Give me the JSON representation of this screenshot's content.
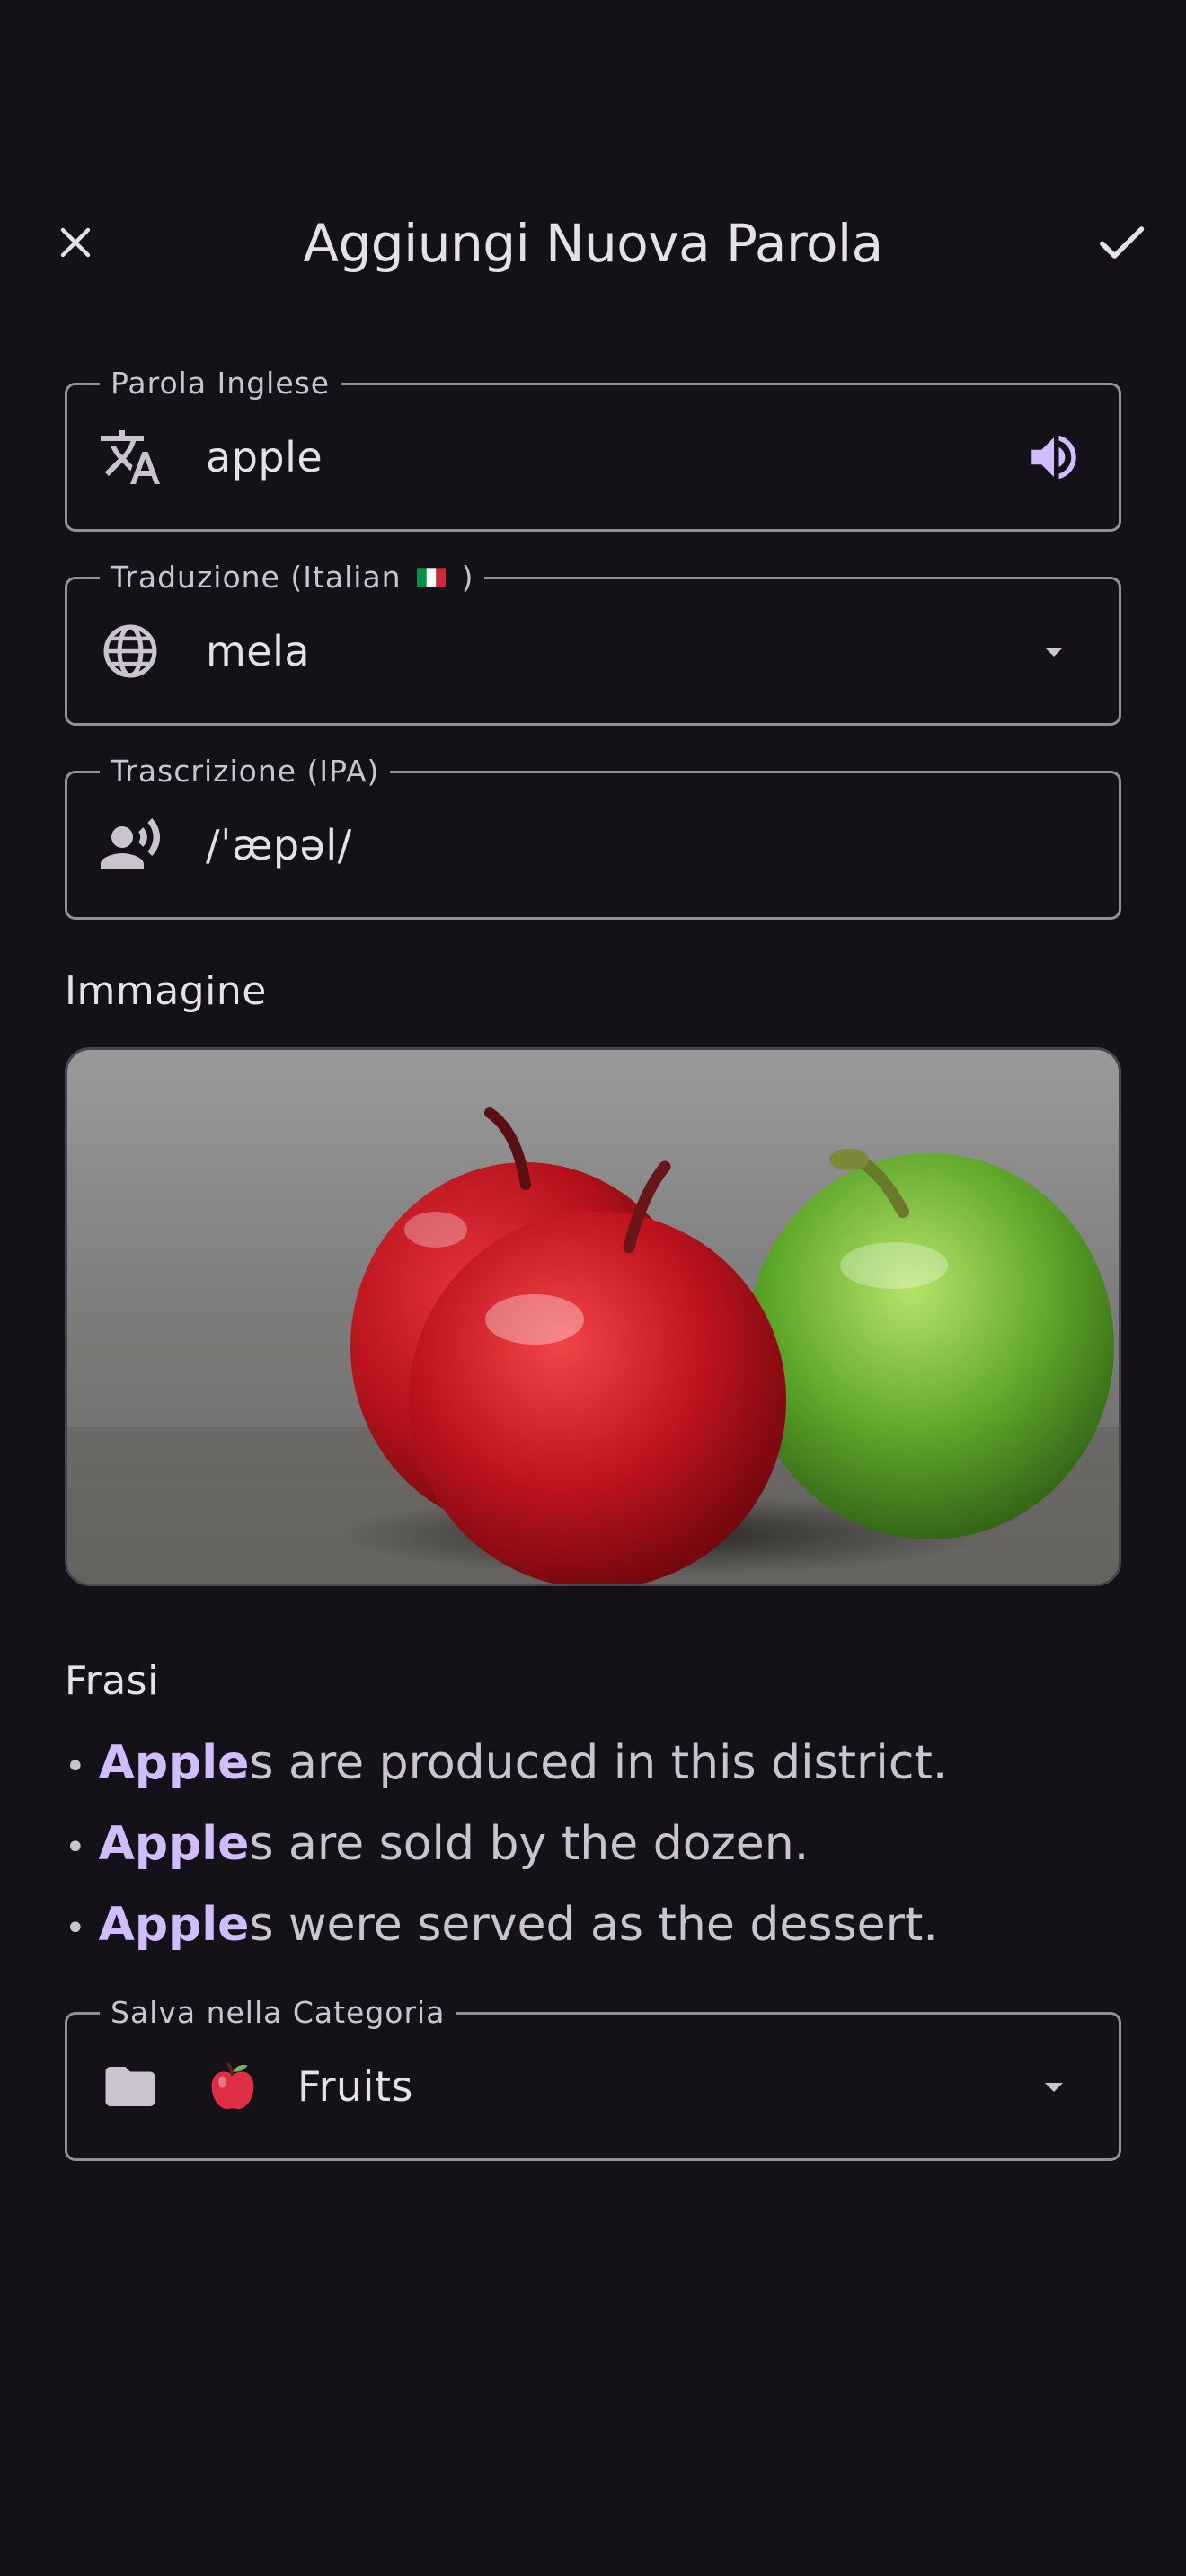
{
  "header": {
    "title": "Aggiungi Nuova Parola",
    "close_icon": "close-icon",
    "confirm_icon": "check-icon"
  },
  "fields": {
    "english": {
      "label": "Parola Inglese",
      "value": "apple",
      "leading_icon": "translate-icon",
      "trailing_icon": "volume-up-icon"
    },
    "translation": {
      "label_prefix": "Traduzione (Italian",
      "label_suffix": ")",
      "flag": "italian-flag-icon",
      "value": "mela",
      "leading_icon": "globe-icon",
      "trailing_icon": "dropdown-arrow-icon"
    },
    "ipa": {
      "label": "Trascrizione (IPA)",
      "value": "/ˈæpəl/",
      "leading_icon": "record-voice-icon"
    }
  },
  "image_section": {
    "label": "Immagine",
    "image_icon": "apples-photo"
  },
  "sentences": {
    "label": "Frasi",
    "bullet": "•",
    "items": [
      {
        "highlight": "Apple",
        "rest": "s are produced in this district."
      },
      {
        "highlight": "Apple",
        "rest": "s are sold by the dozen."
      },
      {
        "highlight": "Apple",
        "rest": "s were served as the dessert."
      }
    ]
  },
  "category": {
    "label": "Salva nella Categoria",
    "value": "Fruits",
    "leading_icon": "folder-icon",
    "emoji_icon": "red-apple-emoji",
    "trailing_icon": "dropdown-arrow-icon"
  },
  "colors": {
    "background": "#141218",
    "accent": "#D0BCFF",
    "outline": "#938F99",
    "text": "#E6E0E9"
  }
}
